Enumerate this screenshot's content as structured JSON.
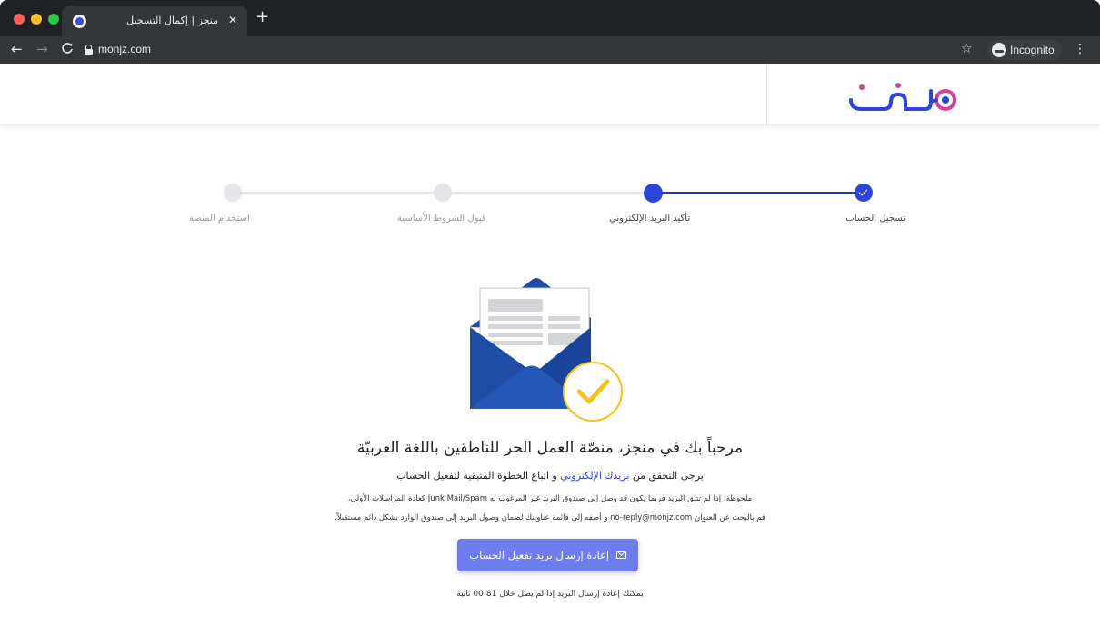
{
  "browser": {
    "tab_title": "منجز | إكمال التسجيل",
    "tab_close": "✕",
    "new_tab": "+",
    "url": "monjz.com",
    "incognito_label": "Incognito",
    "back": "←",
    "forward": "→",
    "reload": "C",
    "star": "☆",
    "menu": "⋮"
  },
  "colors": {
    "brand_blue": "#2c45d6",
    "brand_magenta": "#d63fa0",
    "button": "#6f7cf0",
    "envelope": "#214fa8",
    "check": "#f3c21b"
  },
  "stepper": {
    "steps": [
      {
        "label": "تسجيل الحساب",
        "state": "done"
      },
      {
        "label": "تأكيد البريد الإلكتروني",
        "state": "current"
      },
      {
        "label": "قبول الشروط الأساسية",
        "state": "pending"
      },
      {
        "label": "استخدام المنصة",
        "state": "pending"
      }
    ]
  },
  "content": {
    "welcome": "مرحباً بك في منجز، منصّة العمل الحر للناطقين باللغة العربيّة",
    "instruction_before": "يرجى التحقق من ",
    "instruction_link": "بريدك الإلكتروني",
    "instruction_after": " و اتباع الخطوة المتبقية لتفعيل الحساب",
    "note_line1": "ملحوظة: إذا لم تتلق البريد فربما يكون قد وصل إلى صندوق البريد غير المرغوب به Junk Mail/Spam كعادة المراسلات الأولى،",
    "note_line2": "قم بالبحث عن العنوان no-reply@monjz.com و أضفه إلى قائمة عناوينك لضمان وصول البريد إلى صندوق الوارد بشكل دائم مستقبلاً.",
    "resend_button": "إعادة إرسال بريد تفعيل الحساب",
    "timer_text": "يمكنك إعادة إرسال البريد إذا لم يصل خلال 00:81 ثانية"
  },
  "icons": {
    "logo": "monjz-logo",
    "illustration": "envelope-check-icon",
    "button_icon": "mail-icon"
  }
}
